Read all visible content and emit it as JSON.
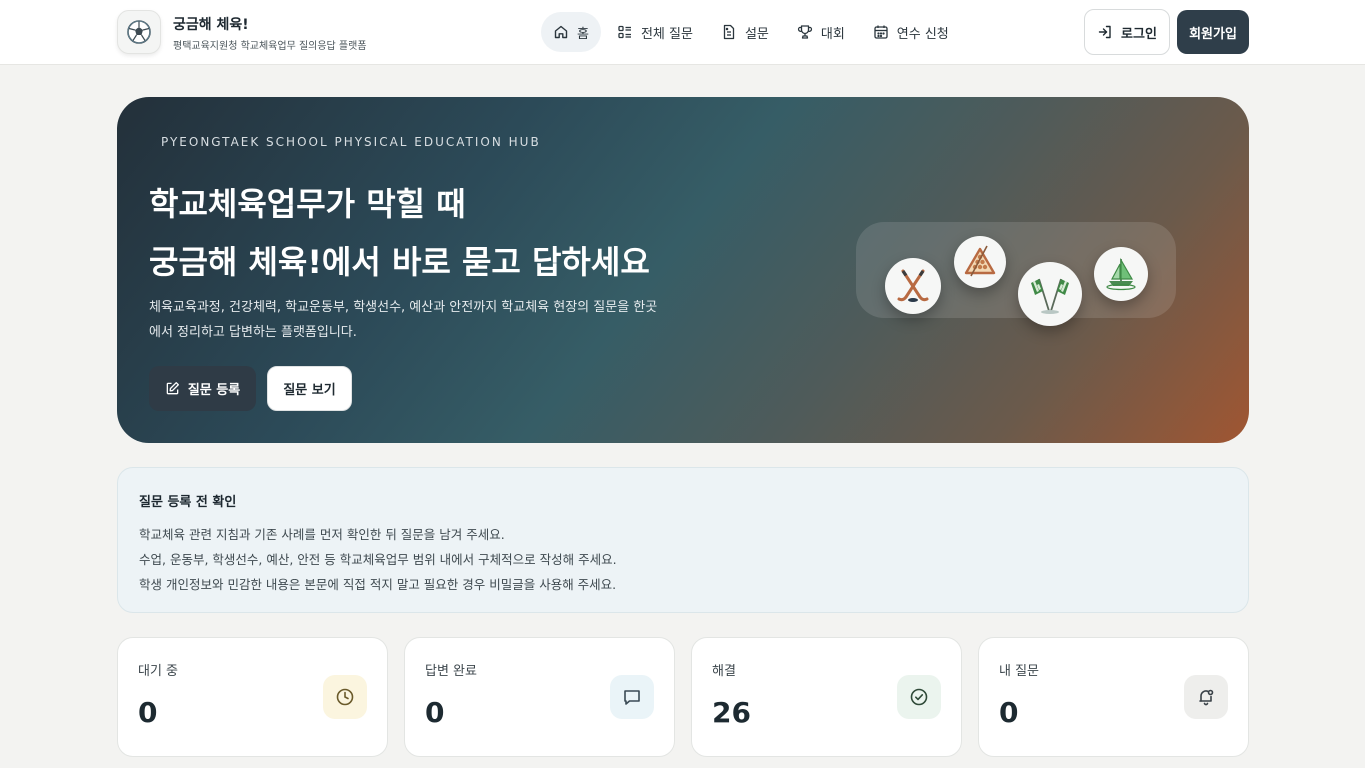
{
  "brand": {
    "title": "궁금해 체육!",
    "subtitle": "평택교육지원청 학교체육업무 질의응답 플랫폼"
  },
  "nav": [
    {
      "label": "홈",
      "icon": "home-icon",
      "active": true
    },
    {
      "label": "전체 질문",
      "icon": "list-icon",
      "active": false
    },
    {
      "label": "설문",
      "icon": "survey-icon",
      "active": false
    },
    {
      "label": "대회",
      "icon": "trophy-icon",
      "active": false
    },
    {
      "label": "연수 신청",
      "icon": "calendar-icon",
      "active": false
    }
  ],
  "auth": {
    "login_label": "로그인",
    "signup_label": "회원가입"
  },
  "hero": {
    "kicker": "PYEONGTAEK SCHOOL PHYSICAL EDUCATION HUB",
    "title_line1": "학교체육업무가 막힐 때",
    "title_line2": "궁금해 체육!에서 바로 묻고 답하세요",
    "desc": "체육교육과정, 건강체력, 학교운동부, 학생선수, 예산과 안전까지 학교체육 현장의 질문을 한곳에서 정리하고 답변하는 플랫폼입니다.",
    "primary_button": "질문 등록",
    "secondary_button": "질문 보기",
    "sports_icons": [
      "hockey-sticks-icon",
      "billiards-triangle-icon",
      "checkered-flags-icon",
      "sailboat-icon"
    ]
  },
  "notice": {
    "title": "질문 등록 전 확인",
    "lines": [
      "학교체육 관련 지침과 기존 사례를 먼저 확인한 뒤 질문을 남겨 주세요.",
      "수업, 운동부, 학생선수, 예산, 안전 등 학교체육업무 범위 내에서 구체적으로 작성해 주세요.",
      "학생 개인정보와 민감한 내용은 본문에 직접 적지 말고 필요한 경우 비밀글을 사용해 주세요."
    ]
  },
  "stats": [
    {
      "label": "대기 중",
      "value": "0",
      "icon": "clock-icon",
      "color": "#fbf5df"
    },
    {
      "label": "답변 완료",
      "value": "0",
      "icon": "chat-icon",
      "color": "#eaf4f8"
    },
    {
      "label": "해결",
      "value": "26",
      "icon": "check-circle-icon",
      "color": "#ebf4ee"
    },
    {
      "label": "내 질문",
      "value": "0",
      "icon": "bell-icon",
      "color": "#eeeeec"
    }
  ]
}
